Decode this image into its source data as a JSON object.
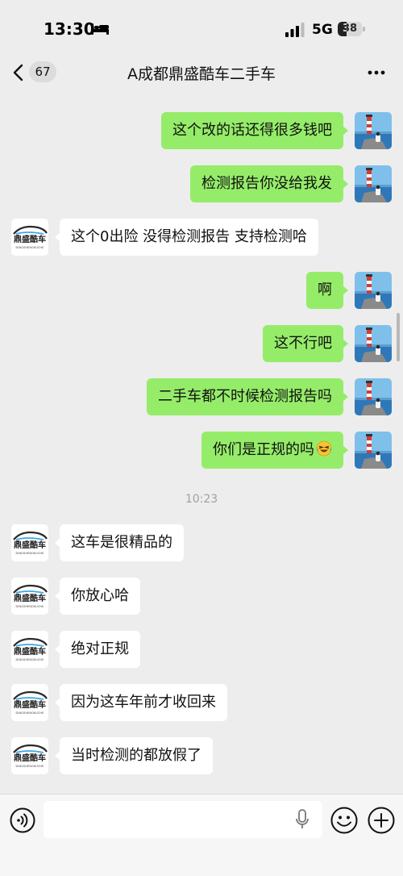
{
  "status_bar": {
    "time": "13:30",
    "network": "5G",
    "battery_level": "38",
    "battery_fraction": 0.38
  },
  "nav": {
    "unread_count": "67",
    "title": "A成都鼎盛酷车二手车"
  },
  "avatars": {
    "self": "lighthouse-photo",
    "contact": {
      "logo_text": "鼎盛酷车",
      "logo_subtext": "DINGSHENGKUCHE"
    }
  },
  "messages": [
    {
      "direction": "sent",
      "text": "这个改的话还得很多钱吧"
    },
    {
      "direction": "sent",
      "text": "检测报告你没给我发"
    },
    {
      "direction": "received",
      "text": "这个0出险 没得检测报告 支持检测哈"
    },
    {
      "direction": "sent",
      "text": "啊"
    },
    {
      "direction": "sent",
      "text": "这不行吧"
    },
    {
      "direction": "sent",
      "text": "二手车都不时候检测报告吗"
    },
    {
      "direction": "sent",
      "text": "你们是正规的吗",
      "emoji": "laughing-crying-emoji"
    },
    {
      "direction": "received",
      "text": "这车是很精品的"
    },
    {
      "direction": "received",
      "text": "你放心哈"
    },
    {
      "direction": "received",
      "text": "绝对正规"
    },
    {
      "direction": "received",
      "text": "因为这车年前才收回来"
    },
    {
      "direction": "received",
      "text": "当时检测的都放假了"
    }
  ],
  "time_divider": "10:23",
  "input_bar": {
    "placeholder": ""
  },
  "colors": {
    "sent_bubble": "#95ec69",
    "received_bubble": "#ffffff",
    "background": "#ededed"
  }
}
